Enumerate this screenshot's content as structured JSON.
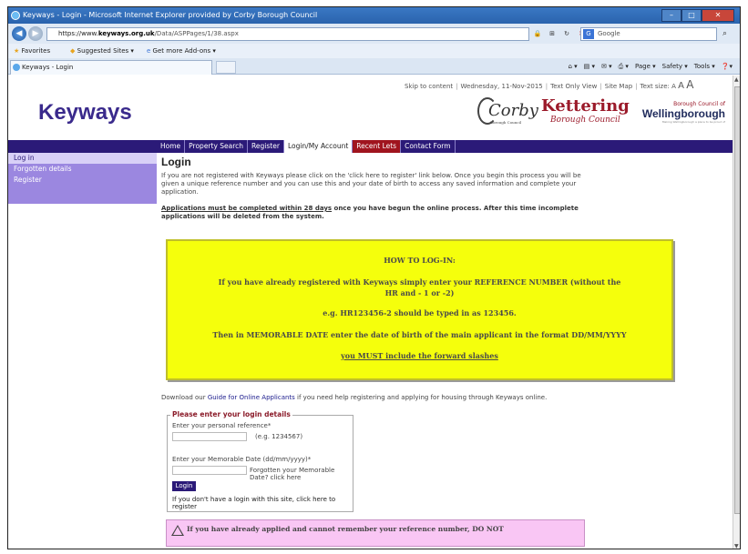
{
  "browser": {
    "title": "Keyways - Login - Microsoft Internet Explorer provided by Corby Borough Council",
    "url_prefix": "https://www.",
    "url_host": "keyways.org.uk",
    "url_path": "/Data/ASPPages/1/38.aspx",
    "search_placeholder": "Google",
    "favorites_label": "Favorites",
    "suggested_sites": "Suggested Sites ▾",
    "get_addons": "Get more Add-ons ▾",
    "tab_label": "Keyways - Login",
    "cmd_page": "Page ▾",
    "cmd_safety": "Safety ▾",
    "cmd_tools": "Tools ▾"
  },
  "toplinks": {
    "skip": "Skip to content",
    "date": "Wednesday, 11-Nov-2015",
    "text_only": "Text Only View",
    "site_map": "Site Map",
    "text_size": "Text size:"
  },
  "logos": {
    "site": "Keyways",
    "corby": "Corby",
    "corby_sub": "Borough Council",
    "kettering": "Kettering",
    "kettering_sub": "Borough Council",
    "wellingborough_top": "Borough Council of",
    "wellingborough": "Wellingborough",
    "wellingborough_tag": "Making Wellingborough a place to be proud of"
  },
  "nav": {
    "items": [
      "Home",
      "Property Search",
      "Register",
      "Login/My Account",
      "Recent Lets",
      "Contact Form"
    ]
  },
  "sidebar": {
    "items": [
      "Log in",
      "Forgotten details",
      "Register"
    ]
  },
  "main": {
    "title": "Login",
    "intro": "If you are not registered with Keyways please click on the 'click here to register' link below. Once you begin this process you will be given a unique reference number and you can use this and your date of birth to access any saved information and complete your application.",
    "notice_strong": "Applications must be completed within 28 days",
    "notice_rest": " once you have begun the online process. After this time incomplete applications will be deleted from the system."
  },
  "howto": {
    "heading": "HOW TO LOG-IN:",
    "line1": "If you have already registered with Keyways simply enter your REFERENCE NUMBER (without the",
    "line1b": "HR and - 1 or -2)",
    "line2": "e.g. HR123456-2 should be typed in as 123456.",
    "line3": "Then in MEMORABLE DATE enter the date of birth of the main applicant in the format DD/MM/YYYY",
    "line4": "you MUST include the forward slashes"
  },
  "guide": {
    "pre": "Download our ",
    "link": "Guide for Online Applicants",
    "post": " if you need help registering and applying for housing through Keyways online."
  },
  "login": {
    "legend": "Please enter your login details",
    "ref_label": "Enter your personal reference*",
    "ref_value": "",
    "ref_hint": "(e.g. 1234567)",
    "date_label": "Enter your Memorable Date (dd/mm/yyyy)*",
    "date_value": "",
    "forgot_date": "Forgotten your Memorable Date? click here",
    "button": "Login",
    "register_text": "If you don't have a login with this site, click here to register"
  },
  "warning": {
    "text": "If you have already applied and cannot remember your reference number, DO NOT"
  }
}
